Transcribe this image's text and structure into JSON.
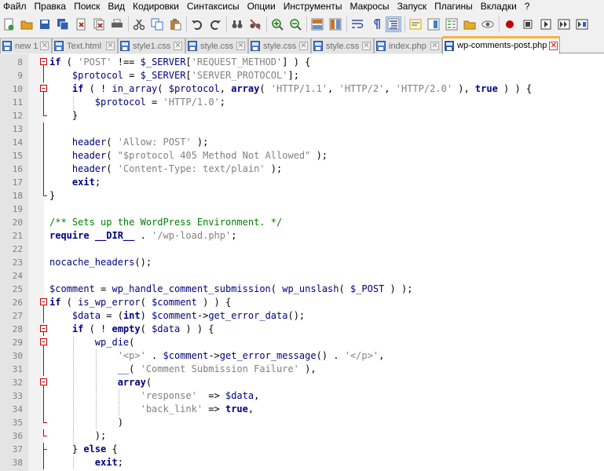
{
  "menu": [
    "Файл",
    "Правка",
    "Поиск",
    "Вид",
    "Кодировки",
    "Синтаксисы",
    "Опции",
    "Инструменты",
    "Макросы",
    "Запуск",
    "Плагины",
    "Вкладки",
    "?"
  ],
  "toolbar": {
    "buttons": [
      {
        "name": "new-file-icon",
        "color": "#3a9a3a"
      },
      {
        "name": "open-file-icon",
        "color": "#e0a020"
      },
      {
        "name": "save-icon",
        "color": "#3060b0"
      },
      {
        "name": "save-all-icon",
        "color": "#3060b0"
      },
      {
        "name": "close-icon",
        "color": "#b03030"
      },
      {
        "name": "close-all-icon",
        "color": "#b03030"
      },
      {
        "name": "print-icon",
        "color": "#606060"
      },
      {
        "name": "sep"
      },
      {
        "name": "cut-icon",
        "color": "#505050"
      },
      {
        "name": "copy-icon",
        "color": "#4070c0"
      },
      {
        "name": "paste-icon",
        "color": "#c08030"
      },
      {
        "name": "sep"
      },
      {
        "name": "undo-icon",
        "color": "#404040"
      },
      {
        "name": "redo-icon",
        "color": "#404040"
      },
      {
        "name": "sep"
      },
      {
        "name": "find-icon",
        "color": "#404040"
      },
      {
        "name": "replace-icon",
        "color": "#c04040"
      },
      {
        "name": "sep"
      },
      {
        "name": "zoom-in-icon",
        "color": "#2a7a2a"
      },
      {
        "name": "zoom-out-icon",
        "color": "#2a7a2a"
      },
      {
        "name": "sep"
      },
      {
        "name": "sync-vertical-icon",
        "color": "#d07020"
      },
      {
        "name": "sync-horizontal-icon",
        "color": "#d07020"
      },
      {
        "name": "sep"
      },
      {
        "name": "word-wrap-icon",
        "color": "#3050a0"
      },
      {
        "name": "show-all-chars-icon",
        "color": "#3050a0"
      },
      {
        "name": "indent-guide-icon",
        "color": "#3050a0",
        "active": true
      },
      {
        "name": "sep"
      },
      {
        "name": "user-language-icon",
        "color": "#d0a020"
      },
      {
        "name": "document-map-icon",
        "color": "#4080c0"
      },
      {
        "name": "function-list-icon",
        "color": "#40a040"
      },
      {
        "name": "folder-workspace-icon",
        "color": "#e0b030"
      },
      {
        "name": "monitoring-icon",
        "color": "#606060"
      },
      {
        "name": "sep"
      },
      {
        "name": "record-macro-icon",
        "color": "#c00000"
      },
      {
        "name": "stop-macro-icon",
        "color": "#404040"
      },
      {
        "name": "play-macro-icon",
        "color": "#404040"
      },
      {
        "name": "play-macro-multiple-icon",
        "color": "#404040"
      },
      {
        "name": "save-macro-icon",
        "color": "#404040"
      }
    ]
  },
  "tabs": [
    {
      "label": "new 1",
      "active": false
    },
    {
      "label": "Text.html",
      "active": false
    },
    {
      "label": "style1.css",
      "active": false
    },
    {
      "label": "style.css",
      "active": false
    },
    {
      "label": "style.css",
      "active": false
    },
    {
      "label": "style.css",
      "active": false
    },
    {
      "label": "index.php",
      "active": false
    },
    {
      "label": "wp-comments-post.php",
      "active": true
    }
  ],
  "editor": {
    "lines": [
      {
        "n": "8",
        "fold": "open",
        "depth": 0,
        "html": "<span class=\"kw\">if</span> ( <span class=\"str\">'POST'</span> !== <span class=\"var\">$_SERVER</span>[<span class=\"str\">'REQUEST_METHOD'</span>] ) {"
      },
      {
        "n": "9",
        "fold": "line",
        "depth": 1,
        "html": "    <span class=\"var\">$protocol</span> = <span class=\"var\">$_SERVER</span>[<span class=\"str\">'SERVER_PROTOCOL'</span>];"
      },
      {
        "n": "10",
        "fold": "open",
        "depth": 1,
        "html": "    <span class=\"kw\">if</span> ( ! <span class=\"fn\">in_array</span>( <span class=\"var\">$protocol</span>, <span class=\"kw\">array</span>( <span class=\"str\">'HTTP/1.1'</span>, <span class=\"str\">'HTTP/2'</span>, <span class=\"str\">'HTTP/2.0'</span> ), <span class=\"kw\">true</span> ) ) {"
      },
      {
        "n": "11",
        "fold": "line",
        "depth": 2,
        "html": "        <span class=\"var\">$protocol</span> = <span class=\"str\">'HTTP/1.0'</span>;"
      },
      {
        "n": "12",
        "fold": "end",
        "depth": 1,
        "html": "    }"
      },
      {
        "n": "13",
        "fold": "line",
        "depth": 0,
        "html": ""
      },
      {
        "n": "14",
        "fold": "line",
        "depth": 1,
        "html": "    <span class=\"fn\">header</span>( <span class=\"str\">'Allow: POST'</span> );"
      },
      {
        "n": "15",
        "fold": "line",
        "depth": 1,
        "html": "    <span class=\"fn\">header</span>( <span class=\"str\">\"$protocol 405 Method Not Allowed\"</span> );"
      },
      {
        "n": "16",
        "fold": "line",
        "depth": 1,
        "html": "    <span class=\"fn\">header</span>( <span class=\"str\">'Content-Type: text/plain'</span> );"
      },
      {
        "n": "17",
        "fold": "line",
        "depth": 1,
        "html": "    <span class=\"kw\">exit</span>;"
      },
      {
        "n": "18",
        "fold": "end",
        "depth": 0,
        "html": "}"
      },
      {
        "n": "19",
        "fold": "none",
        "depth": 0,
        "html": ""
      },
      {
        "n": "20",
        "fold": "none",
        "depth": 0,
        "html": "<span class=\"cmt\">/** Sets up the WordPress Environment. */</span>"
      },
      {
        "n": "21",
        "fold": "none",
        "depth": 0,
        "html": "<span class=\"kw\">require</span> <span class=\"kw\">__DIR__</span> . <span class=\"str\">'/wp-load.php'</span>;"
      },
      {
        "n": "22",
        "fold": "none",
        "depth": 0,
        "html": ""
      },
      {
        "n": "23",
        "fold": "none",
        "depth": 0,
        "html": "<span class=\"fn\">nocache_headers</span>();"
      },
      {
        "n": "24",
        "fold": "none",
        "depth": 0,
        "html": ""
      },
      {
        "n": "25",
        "fold": "none",
        "depth": 0,
        "html": "<span class=\"var\">$comment</span> = <span class=\"fn\">wp_handle_comment_submission</span>( <span class=\"fn\">wp_unslash</span>( <span class=\"var\">$_POST</span> ) );"
      },
      {
        "n": "26",
        "fold": "open",
        "depth": 0,
        "html": "<span class=\"kw\">if</span> ( <span class=\"fn\">is_wp_error</span>( <span class=\"var\">$comment</span> ) ) {"
      },
      {
        "n": "27",
        "fold": "line",
        "depth": 1,
        "html": "    <span class=\"var\">$data</span> = (<span class=\"kw\">int</span>) <span class=\"var\">$comment</span>-&gt;<span class=\"fn\">get_error_data</span>();"
      },
      {
        "n": "28",
        "fold": "open",
        "depth": 1,
        "html": "    <span class=\"kw\">if</span> ( ! <span class=\"kw\">empty</span>( <span class=\"var\">$data</span> ) ) {"
      },
      {
        "n": "29",
        "fold": "open",
        "depth": 2,
        "html": "        <span class=\"fn\">wp_die</span>("
      },
      {
        "n": "30",
        "fold": "line",
        "depth": 3,
        "html": "            <span class=\"str\">'&lt;p&gt;'</span> . <span class=\"var\">$comment</span>-&gt;<span class=\"fn\">get_error_message</span>() . <span class=\"str\">'&lt;/p&gt;'</span>,"
      },
      {
        "n": "31",
        "fold": "line",
        "depth": 3,
        "html": "            <span class=\"fn\">__</span>( <span class=\"str\">'Comment Submission Failure'</span> ),"
      },
      {
        "n": "32",
        "fold": "open",
        "depth": 3,
        "html": "            <span class=\"kw\">array</span>("
      },
      {
        "n": "33",
        "fold": "line",
        "depth": 4,
        "html": "                <span class=\"str\">'response'</span>  =&gt; <span class=\"var\">$data</span>,"
      },
      {
        "n": "34",
        "fold": "line",
        "depth": 4,
        "html": "                <span class=\"str\">'back_link'</span> =&gt; <span class=\"kw\">true</span>,"
      },
      {
        "n": "35",
        "fold": "end",
        "depth": 3,
        "html": "            )"
      },
      {
        "n": "36",
        "fold": "end",
        "depth": 2,
        "html": "        );"
      },
      {
        "n": "37",
        "fold": "mid",
        "depth": 1,
        "html": "    } <span class=\"kw\">else</span> {"
      },
      {
        "n": "38",
        "fold": "line",
        "depth": 2,
        "html": "        <span class=\"kw\">exit</span>;"
      }
    ]
  },
  "colors": {
    "fold_marker": "#c00000",
    "active_tab_accent": "#fab040"
  }
}
